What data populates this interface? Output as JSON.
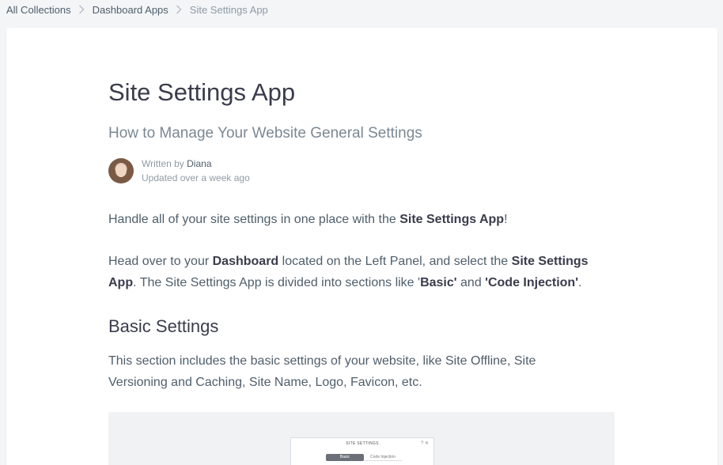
{
  "breadcrumb": {
    "items": [
      {
        "label": "All Collections"
      },
      {
        "label": "Dashboard Apps"
      },
      {
        "label": "Site Settings App"
      }
    ]
  },
  "article": {
    "title": "Site Settings App",
    "subtitle": "How to Manage Your Website General Settings",
    "meta": {
      "written_by": "Written by",
      "author": "Diana",
      "updated": "Updated over a week ago"
    },
    "p1": {
      "text_a": "Handle all of your site settings in one place with the ",
      "bold_a": "Site Settings App",
      "text_b": "!"
    },
    "p2": {
      "text_a": "Head over to your ",
      "bold_a": "Dashboard",
      "text_b": " located on the Left Panel, and select the ",
      "bold_b": "Site Settings App",
      "text_c": ". The Site Settings App is divided into sections like '",
      "bold_c": "Basic'",
      "text_d": " and ",
      "bold_d": "'Code Injection'",
      "text_e": "."
    },
    "section_heading": "Basic Settings",
    "p3": "This section includes the basic settings of your website, like Site Offline, Site Versioning and Caching, Site Name, Logo, Favicon, etc.",
    "screenshot": {
      "dialog_title": "SITE SETTINGS",
      "dialog_icons": "? ✕",
      "tabs": [
        "Basic",
        "Code Injection"
      ]
    }
  },
  "colors": {
    "page_bg": "#f3f5f7",
    "card_bg": "#ffffff",
    "title": "#3a3c4c",
    "body": "#4f5e6b",
    "muted": "#8f9ba6"
  },
  "icons": {
    "breadcrumb_separator": "chevron-right-icon"
  }
}
